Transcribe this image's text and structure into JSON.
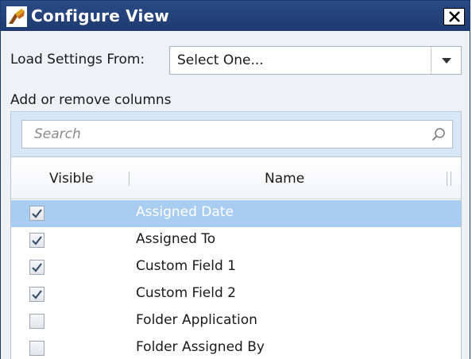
{
  "window": {
    "title": "Configure View",
    "close_label": "×"
  },
  "load_settings": {
    "label": "Load Settings From:",
    "selected": "Select One..."
  },
  "columns": {
    "heading": "Add or remove columns",
    "search_placeholder": "Search",
    "header_visible": "Visible",
    "header_name": "Name",
    "rows": [
      {
        "name": "Assigned Date",
        "visible": true,
        "selected": true
      },
      {
        "name": "Assigned To",
        "visible": true,
        "selected": false
      },
      {
        "name": "Custom Field 1",
        "visible": true,
        "selected": false
      },
      {
        "name": "Custom Field 2",
        "visible": true,
        "selected": false
      },
      {
        "name": "Folder Application",
        "visible": false,
        "selected": false
      },
      {
        "name": "Folder Assigned By",
        "visible": false,
        "selected": false
      }
    ]
  },
  "colors": {
    "titlebar": "#1e3a70",
    "selected_row": "#a8cdf0",
    "panel": "#d7e7f7"
  }
}
